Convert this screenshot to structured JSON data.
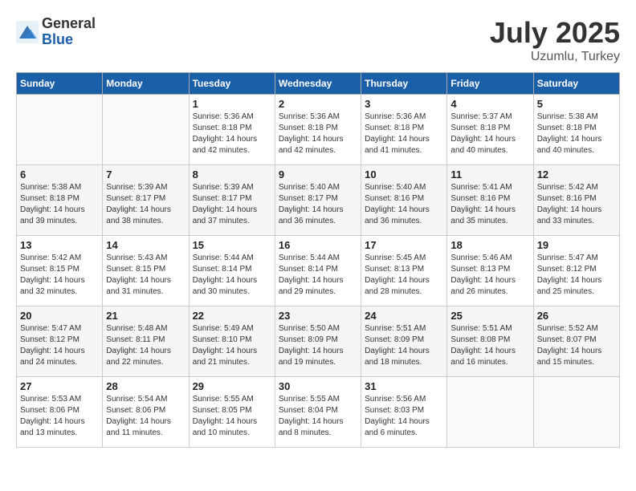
{
  "header": {
    "logo_general": "General",
    "logo_blue": "Blue",
    "title": "July 2025",
    "location": "Uzumlu, Turkey"
  },
  "weekdays": [
    "Sunday",
    "Monday",
    "Tuesday",
    "Wednesday",
    "Thursday",
    "Friday",
    "Saturday"
  ],
  "weeks": [
    [
      {
        "day": null
      },
      {
        "day": null
      },
      {
        "day": "1",
        "sunrise": "Sunrise: 5:36 AM",
        "sunset": "Sunset: 8:18 PM",
        "daylight": "Daylight: 14 hours and 42 minutes."
      },
      {
        "day": "2",
        "sunrise": "Sunrise: 5:36 AM",
        "sunset": "Sunset: 8:18 PM",
        "daylight": "Daylight: 14 hours and 42 minutes."
      },
      {
        "day": "3",
        "sunrise": "Sunrise: 5:36 AM",
        "sunset": "Sunset: 8:18 PM",
        "daylight": "Daylight: 14 hours and 41 minutes."
      },
      {
        "day": "4",
        "sunrise": "Sunrise: 5:37 AM",
        "sunset": "Sunset: 8:18 PM",
        "daylight": "Daylight: 14 hours and 40 minutes."
      },
      {
        "day": "5",
        "sunrise": "Sunrise: 5:38 AM",
        "sunset": "Sunset: 8:18 PM",
        "daylight": "Daylight: 14 hours and 40 minutes."
      }
    ],
    [
      {
        "day": "6",
        "sunrise": "Sunrise: 5:38 AM",
        "sunset": "Sunset: 8:18 PM",
        "daylight": "Daylight: 14 hours and 39 minutes."
      },
      {
        "day": "7",
        "sunrise": "Sunrise: 5:39 AM",
        "sunset": "Sunset: 8:17 PM",
        "daylight": "Daylight: 14 hours and 38 minutes."
      },
      {
        "day": "8",
        "sunrise": "Sunrise: 5:39 AM",
        "sunset": "Sunset: 8:17 PM",
        "daylight": "Daylight: 14 hours and 37 minutes."
      },
      {
        "day": "9",
        "sunrise": "Sunrise: 5:40 AM",
        "sunset": "Sunset: 8:17 PM",
        "daylight": "Daylight: 14 hours and 36 minutes."
      },
      {
        "day": "10",
        "sunrise": "Sunrise: 5:40 AM",
        "sunset": "Sunset: 8:16 PM",
        "daylight": "Daylight: 14 hours and 36 minutes."
      },
      {
        "day": "11",
        "sunrise": "Sunrise: 5:41 AM",
        "sunset": "Sunset: 8:16 PM",
        "daylight": "Daylight: 14 hours and 35 minutes."
      },
      {
        "day": "12",
        "sunrise": "Sunrise: 5:42 AM",
        "sunset": "Sunset: 8:16 PM",
        "daylight": "Daylight: 14 hours and 33 minutes."
      }
    ],
    [
      {
        "day": "13",
        "sunrise": "Sunrise: 5:42 AM",
        "sunset": "Sunset: 8:15 PM",
        "daylight": "Daylight: 14 hours and 32 minutes."
      },
      {
        "day": "14",
        "sunrise": "Sunrise: 5:43 AM",
        "sunset": "Sunset: 8:15 PM",
        "daylight": "Daylight: 14 hours and 31 minutes."
      },
      {
        "day": "15",
        "sunrise": "Sunrise: 5:44 AM",
        "sunset": "Sunset: 8:14 PM",
        "daylight": "Daylight: 14 hours and 30 minutes."
      },
      {
        "day": "16",
        "sunrise": "Sunrise: 5:44 AM",
        "sunset": "Sunset: 8:14 PM",
        "daylight": "Daylight: 14 hours and 29 minutes."
      },
      {
        "day": "17",
        "sunrise": "Sunrise: 5:45 AM",
        "sunset": "Sunset: 8:13 PM",
        "daylight": "Daylight: 14 hours and 28 minutes."
      },
      {
        "day": "18",
        "sunrise": "Sunrise: 5:46 AM",
        "sunset": "Sunset: 8:13 PM",
        "daylight": "Daylight: 14 hours and 26 minutes."
      },
      {
        "day": "19",
        "sunrise": "Sunrise: 5:47 AM",
        "sunset": "Sunset: 8:12 PM",
        "daylight": "Daylight: 14 hours and 25 minutes."
      }
    ],
    [
      {
        "day": "20",
        "sunrise": "Sunrise: 5:47 AM",
        "sunset": "Sunset: 8:12 PM",
        "daylight": "Daylight: 14 hours and 24 minutes."
      },
      {
        "day": "21",
        "sunrise": "Sunrise: 5:48 AM",
        "sunset": "Sunset: 8:11 PM",
        "daylight": "Daylight: 14 hours and 22 minutes."
      },
      {
        "day": "22",
        "sunrise": "Sunrise: 5:49 AM",
        "sunset": "Sunset: 8:10 PM",
        "daylight": "Daylight: 14 hours and 21 minutes."
      },
      {
        "day": "23",
        "sunrise": "Sunrise: 5:50 AM",
        "sunset": "Sunset: 8:09 PM",
        "daylight": "Daylight: 14 hours and 19 minutes."
      },
      {
        "day": "24",
        "sunrise": "Sunrise: 5:51 AM",
        "sunset": "Sunset: 8:09 PM",
        "daylight": "Daylight: 14 hours and 18 minutes."
      },
      {
        "day": "25",
        "sunrise": "Sunrise: 5:51 AM",
        "sunset": "Sunset: 8:08 PM",
        "daylight": "Daylight: 14 hours and 16 minutes."
      },
      {
        "day": "26",
        "sunrise": "Sunrise: 5:52 AM",
        "sunset": "Sunset: 8:07 PM",
        "daylight": "Daylight: 14 hours and 15 minutes."
      }
    ],
    [
      {
        "day": "27",
        "sunrise": "Sunrise: 5:53 AM",
        "sunset": "Sunset: 8:06 PM",
        "daylight": "Daylight: 14 hours and 13 minutes."
      },
      {
        "day": "28",
        "sunrise": "Sunrise: 5:54 AM",
        "sunset": "Sunset: 8:06 PM",
        "daylight": "Daylight: 14 hours and 11 minutes."
      },
      {
        "day": "29",
        "sunrise": "Sunrise: 5:55 AM",
        "sunset": "Sunset: 8:05 PM",
        "daylight": "Daylight: 14 hours and 10 minutes."
      },
      {
        "day": "30",
        "sunrise": "Sunrise: 5:55 AM",
        "sunset": "Sunset: 8:04 PM",
        "daylight": "Daylight: 14 hours and 8 minutes."
      },
      {
        "day": "31",
        "sunrise": "Sunrise: 5:56 AM",
        "sunset": "Sunset: 8:03 PM",
        "daylight": "Daylight: 14 hours and 6 minutes."
      },
      {
        "day": null
      },
      {
        "day": null
      }
    ]
  ]
}
